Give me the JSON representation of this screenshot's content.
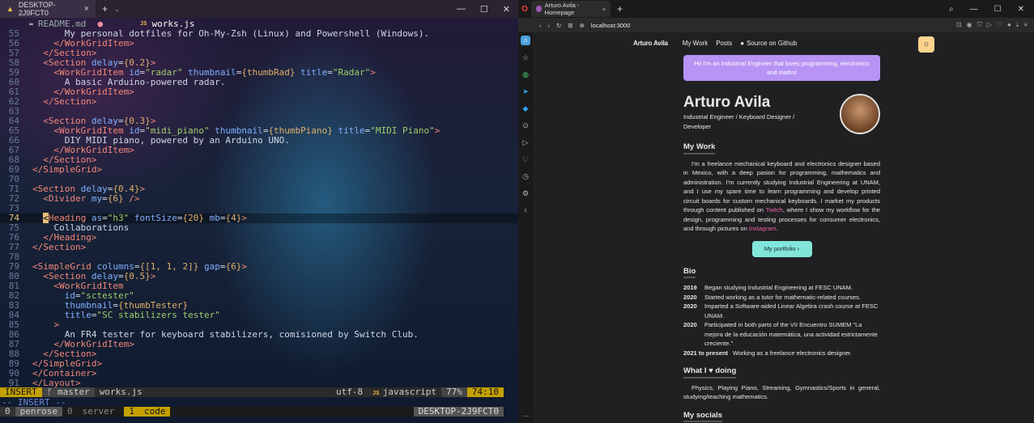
{
  "terminal": {
    "tab_title": "DESKTOP-2J9FCT0",
    "buffers": [
      {
        "name": "README.md"
      },
      {
        "name": "works.js"
      }
    ],
    "lines": [
      {
        "n": "55",
        "html": "      My personal dotfiles for Oh-My-Zsh (Linux) and Powershell (Windows)."
      },
      {
        "n": "56",
        "html": "    <span class='tag'>&lt;/WorkGridItem&gt;</span>"
      },
      {
        "n": "57",
        "html": "  <span class='tag'>&lt;/Section&gt;</span>"
      },
      {
        "n": "58",
        "html": "  <span class='tag'>&lt;Section</span> <span class='attr'>delay</span>=<span class='br'>{0.2}</span><span class='tag'>&gt;</span>"
      },
      {
        "n": "59",
        "html": "    <span class='tag'>&lt;WorkGridItem</span> <span class='attr'>id</span>=<span class='str'>\"radar\"</span> <span class='attr'>thumbnail</span>=<span class='br'>{thumbRad}</span> <span class='attr'>title</span>=<span class='str'>\"Radar\"</span><span class='tag'>&gt;</span>"
      },
      {
        "n": "60",
        "html": "      A basic Arduino-powered radar."
      },
      {
        "n": "61",
        "html": "    <span class='tag'>&lt;/WorkGridItem&gt;</span>"
      },
      {
        "n": "62",
        "html": "  <span class='tag'>&lt;/Section&gt;</span>"
      },
      {
        "n": "63",
        "html": ""
      },
      {
        "n": "64",
        "html": "  <span class='tag'>&lt;Section</span> <span class='attr'>delay</span>=<span class='br'>{0.3}</span><span class='tag'>&gt;</span>"
      },
      {
        "n": "65",
        "html": "    <span class='tag'>&lt;WorkGridItem</span> <span class='attr'>id</span>=<span class='str'>\"midi_piano\"</span> <span class='attr'>thumbnail</span>=<span class='br'>{thumbPiano}</span> <span class='attr'>title</span>=<span class='str'>\"MIDI Piano\"</span><span class='tag'>&gt;</span>"
      },
      {
        "n": "66",
        "html": "      DIY MIDI piano, powered by an Arduino UNO."
      },
      {
        "n": "67",
        "html": "    <span class='tag'>&lt;/WorkGridItem&gt;</span>"
      },
      {
        "n": "68",
        "html": "  <span class='tag'>&lt;/Section&gt;</span>"
      },
      {
        "n": "69",
        "html": "<span class='tag'>&lt;/SimpleGrid&gt;</span>"
      },
      {
        "n": "70",
        "html": ""
      },
      {
        "n": "71",
        "html": "<span class='tag'>&lt;Section</span> <span class='attr'>delay</span>=<span class='br'>{0.4}</span><span class='tag'>&gt;</span>"
      },
      {
        "n": "72",
        "html": "  <span class='tag'>&lt;Divider</span> <span class='attr'>my</span>=<span class='br'>{6}</span> <span class='tag'>/&gt;</span>"
      },
      {
        "n": "73",
        "html": ""
      },
      {
        "n": "74",
        "html": "  <span class='cursor'>&lt;</span><span class='tag'>Heading</span> <span class='attr'>as</span>=<span class='str'>\"h3\"</span> <span class='attr'>fontSize</span>=<span class='br'>{20}</span> <span class='attr'>mb</span>=<span class='br'>{4}</span><span class='tag'>&gt;</span>",
        "current": true
      },
      {
        "n": "75",
        "html": "    Collaborations"
      },
      {
        "n": "76",
        "html": "  <span class='tag'>&lt;/Heading&gt;</span>"
      },
      {
        "n": "77",
        "html": "<span class='tag'>&lt;/Section&gt;</span>"
      },
      {
        "n": "78",
        "html": ""
      },
      {
        "n": "79",
        "html": "<span class='tag'>&lt;SimpleGrid</span> <span class='attr'>columns</span>=<span class='br'>{[1, 1, 2]}</span> <span class='attr'>gap</span>=<span class='br'>{6}</span><span class='tag'>&gt;</span>"
      },
      {
        "n": "80",
        "html": "  <span class='tag'>&lt;Section</span> <span class='attr'>delay</span>=<span class='br'>{0.5}</span><span class='tag'>&gt;</span>"
      },
      {
        "n": "81",
        "html": "    <span class='tag'>&lt;WorkGridItem</span>"
      },
      {
        "n": "82",
        "html": "      <span class='attr'>id</span>=<span class='str'>\"sctester\"</span>"
      },
      {
        "n": "83",
        "html": "      <span class='attr'>thumbnail</span>=<span class='br'>{thumbTester}</span>"
      },
      {
        "n": "84",
        "html": "      <span class='attr'>title</span>=<span class='str'>\"SC stabilizers tester\"</span>"
      },
      {
        "n": "85",
        "html": "    <span class='tag'>&gt;</span>"
      },
      {
        "n": "86",
        "html": "      An FR4 tester for keyboard stabilizers, comisioned by Switch Club."
      },
      {
        "n": "87",
        "html": "    <span class='tag'>&lt;/WorkGridItem&gt;</span>"
      },
      {
        "n": "88",
        "html": "  <span class='tag'>&lt;/Section&gt;</span>"
      },
      {
        "n": "89",
        "html": "<span class='tag'>&lt;/SimpleGrid&gt;</span>"
      },
      {
        "n": "90",
        "html": "<span class='tag'>&lt;/Container&gt;</span>"
      },
      {
        "n": "91",
        "html": "<span class='tag'>&lt;/Layout&gt;</span>"
      }
    ],
    "status": {
      "mode": "INSERT",
      "branch": "master",
      "file": "works.js",
      "encoding": "utf-8",
      "filetype": "javascript",
      "percent": "77%",
      "position": "74:10"
    },
    "mode_line": "-- INSERT --",
    "tmux": {
      "w0_index": "0",
      "w0_name": "penrose",
      "w1_index": "0",
      "w1_name": "server",
      "w2_index": "1",
      "w2_name": "code",
      "host": "DESKTOP-2J9FCT0"
    }
  },
  "browser": {
    "tab_title": "Arturo Avila - Homepage",
    "url": "localhost:3000",
    "nav": {
      "logo": "Arturo Avila",
      "links": [
        "My Work",
        "Posts",
        "Source on Github"
      ]
    },
    "hello": "Hi! I'm an Industrial Engineer that loves programming, electronics and maths!",
    "name": "Arturo Avila",
    "role": "Industrial Engineer / Keyboard Designer / Developer",
    "work_heading": "My Work",
    "work_p1": "I'm a freelance mechanical keyboard and electronics designer based in Mexico, with a deep pasion for programming, mathematics and administration. I'm currently studying Industrial Engineering at UNAM, and I use my spare time to learn programming and develop printed circuit boards for custom mechanical keyboards. I market my products through content published on ",
    "work_link1": "Twitch",
    "work_p2": ", where I show my workflow for the design, programming and testing processes for consumer electronics, and through pictures on ",
    "work_link2": "Instagram",
    "work_p3": ".",
    "portfolio_button": "My portfolio  ›",
    "bio_heading": "Bio",
    "bio": [
      {
        "year": "2019",
        "text": "Began studying Industrial Engineering at FESC UNAM."
      },
      {
        "year": "2020",
        "text": "Started working as a tutor for mathematic-related courses."
      },
      {
        "year": "2020",
        "text": "Imparted a Software-aided Linear Algebra crash course at FESC UNAM."
      },
      {
        "year": "2020",
        "text": "Participated in both parts of the VII Encuentro SUMEM \"La mejora de la educación matemática, una actividad estrictamente creciente.\""
      },
      {
        "year": "2021 to present",
        "text": "Working as a freelance electronics designer."
      }
    ],
    "doing_heading": "What I ♥ doing",
    "doing_text": "Physics, Playing Piano, Streaming, Gymnastics/Sports in general, studying/teaching mathematics.",
    "socials_heading": "My socials"
  }
}
